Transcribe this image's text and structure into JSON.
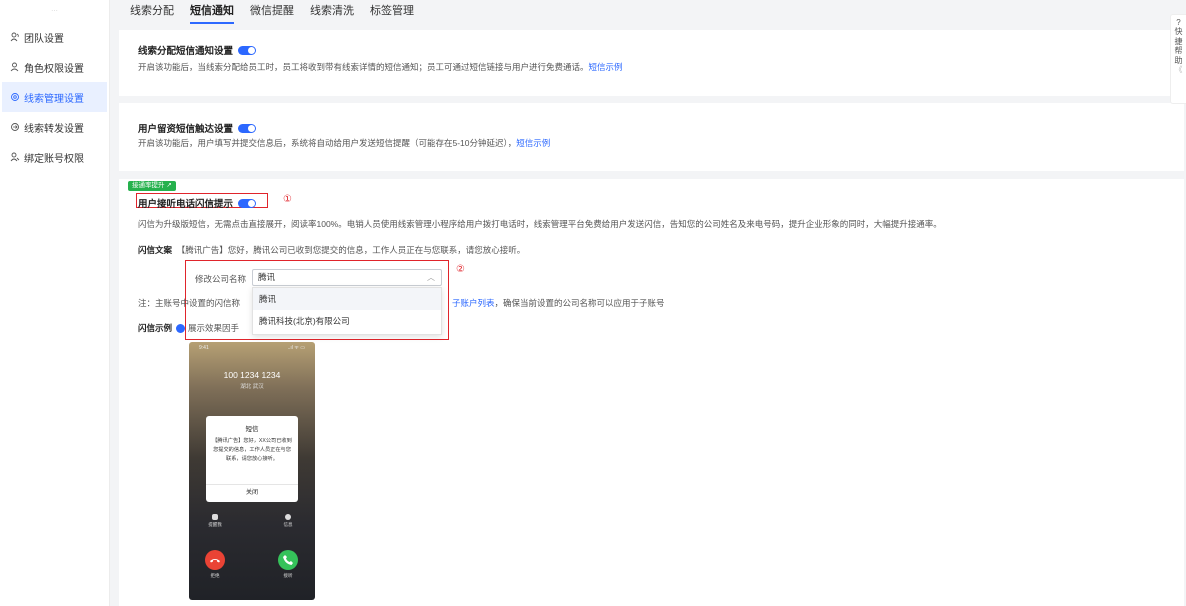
{
  "sidebar": {
    "logo": "...",
    "items": [
      {
        "label": "团队设置",
        "icon": "team-icon"
      },
      {
        "label": "角色权限设置",
        "icon": "role-icon"
      },
      {
        "label": "线索管理设置",
        "icon": "settings-icon",
        "active": true
      },
      {
        "label": "线索转发设置",
        "icon": "forward-icon"
      },
      {
        "label": "绑定账号权限",
        "icon": "bind-icon"
      }
    ]
  },
  "tabs": [
    "线索分配",
    "短信通知",
    "微信提醒",
    "线索清洗",
    "标签管理"
  ],
  "active_tab": "短信通知",
  "section1": {
    "title": "线索分配短信通知设置",
    "desc": "开启该功能后，当线索分配给员工时，员工将收到带有线索详情的短信通知；员工可通过短信链接与用户进行免费通话。",
    "link": "短信示例"
  },
  "section2": {
    "title": "用户留资短信触达设置",
    "desc": "开启该功能后，用户填写并提交信息后，系统将自动给用户发送短信提醒（可能存在5-10分钟延迟），",
    "link": "短信示例"
  },
  "section3": {
    "badge": "接通率提升",
    "title": "用户接听电话闪信提示",
    "mark1": "①",
    "mark2": "②",
    "desc": "闪信为升级版短信，无需点击直接展开，阅读率100%。电销人员使用线索管理小程序给用户拨打电话时，线索管理平台免费给用户发送闪信，告知您的公司姓名及来电号码，提升企业形象的同时，大幅提升接通率。",
    "copy_label": "闪信文案",
    "copy_text": "【腾讯广告】您好，腾讯公司已收到您提交的信息，工作人员正在与您联系，请您放心接听。",
    "company_label": "修改公司名称",
    "company_value": "腾讯",
    "dropdown_options": [
      "腾讯",
      "腾讯科技(北京)有限公司"
    ],
    "note_prefix": "注：主账号中设置的闪信称",
    "note_link": "子账户列表",
    "note_suffix": "，确保当前设置的公司名称可以应用于子账号",
    "sample_label": "闪信示例",
    "sample_tip": "展示效果因手"
  },
  "phone": {
    "time": "9:41",
    "signal": "..ıl ᯤ ▭",
    "number": "100 1234 1234",
    "location": "湖北 武汉",
    "dialog_title": "短信",
    "dialog_text": "【腾讯广告】您好，XX公司已收到您提交的信息，工作人员正在与您联系，请您放心接听。",
    "dialog_button": "关闭",
    "remind_label": "提醒我",
    "message_label": "信息",
    "decline_label": "拒绝",
    "accept_label": "接听"
  },
  "help": {
    "icon": "?",
    "text": [
      "快",
      "捷",
      "帮",
      "助"
    ],
    "collapse": "《"
  }
}
